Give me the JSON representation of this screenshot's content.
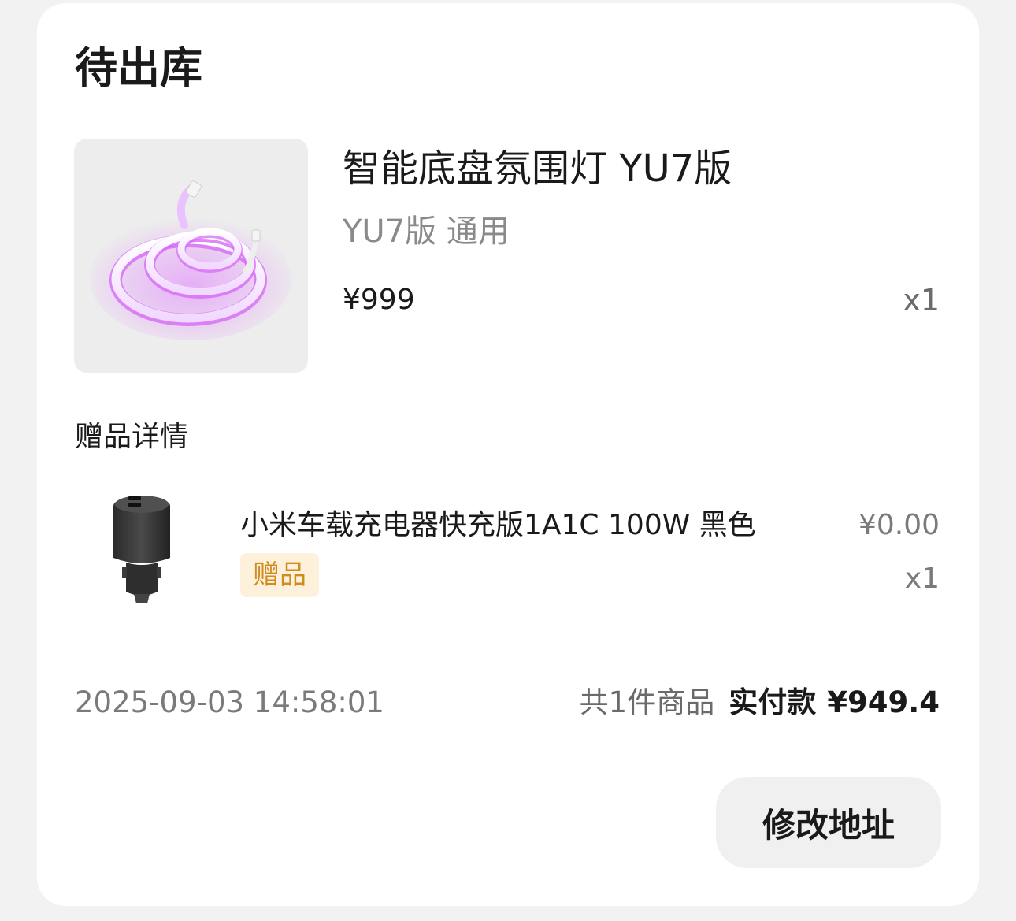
{
  "order": {
    "status": "待出库",
    "product": {
      "image_icon": "ambient-light-strip-image",
      "name": "智能底盘氛围灯 YU7版",
      "spec": "YU7版 通用",
      "price": "¥999",
      "qty": "x1"
    },
    "gift_section": {
      "heading": "赠品详情",
      "item": {
        "image_icon": "car-charger-image",
        "name": "小米车载充电器快充版1A1C 100W 黑色",
        "badge": "赠品",
        "price": "¥0.00",
        "qty": "x1"
      }
    },
    "footer": {
      "timestamp": "2025-09-03 14:58:01",
      "item_count": "共1件商品",
      "paid_label": "实付款",
      "paid_amount": "¥949.4"
    },
    "actions": {
      "modify_address": "修改地址"
    }
  },
  "colors": {
    "background": "#f2f2f2",
    "card": "#ffffff",
    "badge_bg": "#fdf1dc",
    "badge_text": "#cf8d1f",
    "button_bg": "#f0f0f0",
    "muted_text": "#7a7a7a"
  }
}
